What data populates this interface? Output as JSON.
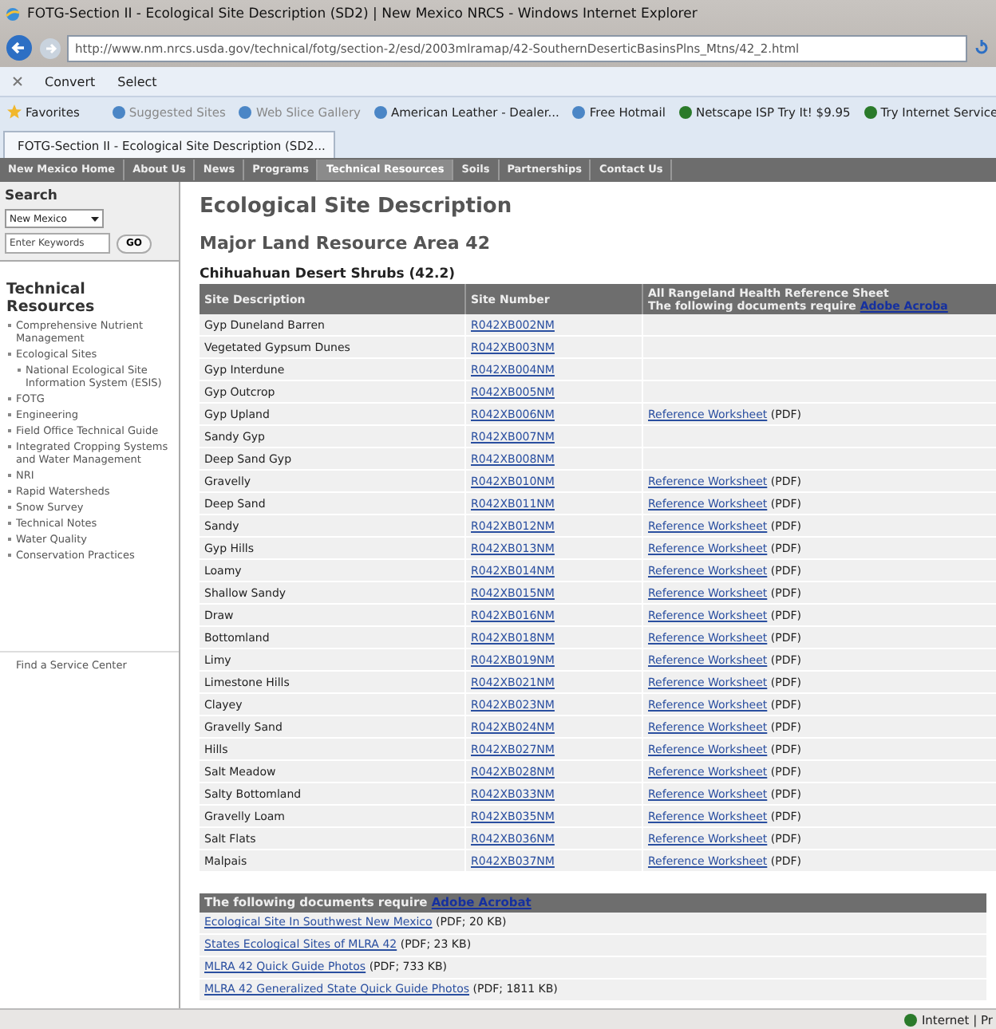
{
  "window": {
    "title": "FOTG-Section II - Ecological Site Description (SD2) | New Mexico NRCS - Windows Internet Explorer"
  },
  "address": "http://www.nm.nrcs.usda.gov/technical/fotg/section-2/esd/2003mlramap/42-SouthernDeserticBasinsPlns_Mtns/42_2.html",
  "toolbar": [
    "Convert",
    "Select"
  ],
  "favorites": {
    "label": "Favorites",
    "items": [
      "Suggested Sites",
      "Web Slice Gallery",
      "American Leather - Dealer...",
      "Free Hotmail",
      "Netscape ISP Try It! $9.95",
      "Try Internet Service"
    ]
  },
  "tab": {
    "title": "FOTG-Section II - Ecological Site Description (SD2..."
  },
  "nav": [
    {
      "label": "New Mexico Home",
      "selected": false
    },
    {
      "label": "About Us",
      "selected": false
    },
    {
      "label": "News",
      "selected": false
    },
    {
      "label": "Programs",
      "selected": false
    },
    {
      "label": "Technical Resources",
      "selected": true
    },
    {
      "label": "Soils",
      "selected": false
    },
    {
      "label": "Partnerships",
      "selected": false
    },
    {
      "label": "Contact Us",
      "selected": false
    }
  ],
  "sidebar": {
    "search_title": "Search",
    "state": "New Mexico",
    "placeholder": "Enter Keywords",
    "go": "GO",
    "section_title": "Technical Resources",
    "items": [
      {
        "label": "Comprehensive Nutrient Management"
      },
      {
        "label": "Ecological Sites",
        "children": [
          {
            "label": "National Ecological Site Information System (ESIS)"
          }
        ]
      },
      {
        "label": "FOTG"
      },
      {
        "label": "Engineering"
      },
      {
        "label": "Field Office Technical Guide"
      },
      {
        "label": "Integrated Cropping Systems and Water Management"
      },
      {
        "label": "NRI"
      },
      {
        "label": "Rapid Watersheds"
      },
      {
        "label": "Snow Survey"
      },
      {
        "label": "Technical Notes"
      },
      {
        "label": "Water Quality"
      },
      {
        "label": "Conservation Practices"
      }
    ],
    "bottom_link": "Find a Service Center"
  },
  "heading": "Ecological Site Description",
  "subheading": "Major Land Resource Area  42",
  "table_title": "Chihuahuan Desert Shrubs (42.2)",
  "table": {
    "columns": [
      "Site Description",
      "Site Number"
    ],
    "column_3": {
      "line_1": "All Rangeland Health Reference Sheet",
      "line_2": "The following documents require",
      "link": "Adobe Acroba"
    },
    "rows": [
      {
        "name": "Gyp Duneland Barren",
        "number": "R042XB002NM"
      },
      {
        "name": "Vegetated Gypsum Dunes",
        "number": "R042XB003NM"
      },
      {
        "name": "Gyp Interdune",
        "number": "R042XB004NM"
      },
      {
        "name": "Gyp Outcrop",
        "number": "R042XB005NM"
      },
      {
        "name": "Gyp Upland",
        "number": "R042XB006NM",
        "ref": "Reference Worksheet",
        "format": "(PDF)"
      },
      {
        "name": "Sandy Gyp",
        "number": "R042XB007NM"
      },
      {
        "name": "Deep Sand Gyp",
        "number": "R042XB008NM"
      },
      {
        "name": "Gravelly",
        "number": "R042XB010NM",
        "ref": "Reference Worksheet",
        "format": "(PDF)"
      },
      {
        "name": "Deep Sand",
        "number": "R042XB011NM",
        "ref": "Reference Worksheet",
        "format": "(PDF)"
      },
      {
        "name": "Sandy",
        "number": "R042XB012NM",
        "ref": "Reference Worksheet",
        "format": "(PDF)"
      },
      {
        "name": "Gyp Hills",
        "number": "R042XB013NM",
        "ref": "Reference Worksheet",
        "format": "(PDF)"
      },
      {
        "name": "Loamy",
        "number": "R042XB014NM",
        "ref": "Reference Worksheet",
        "format": "(PDF)"
      },
      {
        "name": "Shallow Sandy",
        "number": "R042XB015NM",
        "ref": "Reference Worksheet",
        "format": "(PDF)"
      },
      {
        "name": "Draw",
        "number": "R042XB016NM",
        "ref": "Reference Worksheet",
        "format": "(PDF)"
      },
      {
        "name": "Bottomland",
        "number": "R042XB018NM",
        "ref": "Reference Worksheet",
        "format": "(PDF)"
      },
      {
        "name": "Limy",
        "number": "R042XB019NM",
        "ref": "Reference Worksheet",
        "format": "(PDF)"
      },
      {
        "name": "Limestone Hills",
        "number": "R042XB021NM",
        "ref": "Reference Worksheet",
        "format": "(PDF)"
      },
      {
        "name": "Clayey",
        "number": "R042XB023NM",
        "ref": "Reference Worksheet",
        "format": "(PDF)"
      },
      {
        "name": "Gravelly Sand",
        "number": "R042XB024NM",
        "ref": "Reference Worksheet",
        "format": "(PDF)"
      },
      {
        "name": "Hills",
        "number": "R042XB027NM",
        "ref": "Reference Worksheet",
        "format": "(PDF)"
      },
      {
        "name": "Salt Meadow",
        "number": "R042XB028NM",
        "ref": "Reference Worksheet",
        "format": "(PDF)"
      },
      {
        "name": "Salty Bottomland",
        "number": "R042XB033NM",
        "ref": "Reference Worksheet",
        "format": "(PDF)"
      },
      {
        "name": "Gravelly Loam",
        "number": "R042XB035NM",
        "ref": "Reference Worksheet",
        "format": "(PDF)"
      },
      {
        "name": "Salt Flats",
        "number": "R042XB036NM",
        "ref": "Reference Worksheet",
        "format": "(PDF)"
      },
      {
        "name": "Malpais",
        "number": "R042XB037NM",
        "ref": "Reference Worksheet",
        "format": "(PDF)"
      }
    ]
  },
  "documents": {
    "header": "The following documents require",
    "header_link": "Adobe Acrobat",
    "items": [
      {
        "link": "Ecological Site In Southwest New Mexico",
        "info": "(PDF; 20 KB)"
      },
      {
        "link": "States Ecological Sites of MLRA 42",
        "info": "(PDF; 23 KB)"
      },
      {
        "link": "MLRA 42 Quick Guide Photos",
        "info": "(PDF; 733 KB)"
      },
      {
        "link": "MLRA 42 Generalized State Quick Guide Photos",
        "info": "(PDF; 1811 KB)"
      }
    ]
  },
  "status_bar": {
    "zone": "Internet | Pr"
  }
}
